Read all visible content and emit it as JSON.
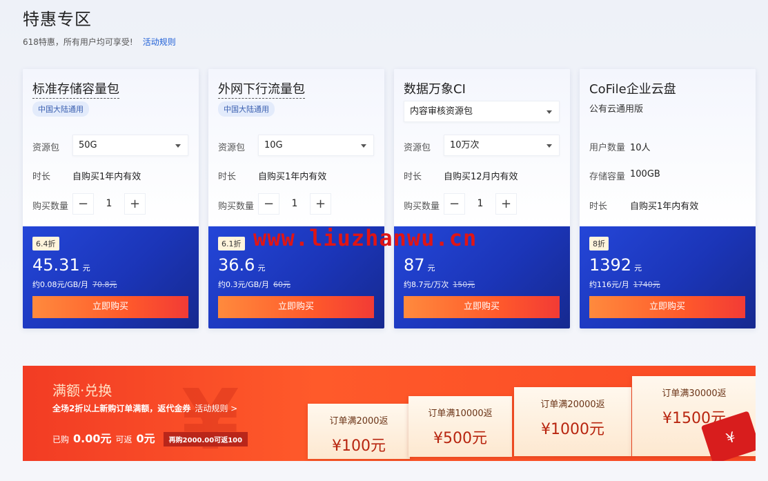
{
  "page": {
    "title": "特惠专区",
    "subtitle": "618特惠，所有用户均可享受!",
    "rules_link": "活动规则"
  },
  "cards": [
    {
      "title": "标准存储容量包",
      "tag": "中国大陆通用",
      "resource_label": "资源包",
      "resource_value": "50G",
      "duration_label": "时长",
      "duration_value": "自购买1年内有效",
      "quantity_label": "购买数量",
      "quantity": "1",
      "discount": "6.4折",
      "price": "45.31",
      "currency": "元",
      "unit_price": "约0.08元/GB/月",
      "original_price": "70.8元",
      "buy_label": "立即购买"
    },
    {
      "title": "外网下行流量包",
      "tag": "中国大陆通用",
      "resource_label": "资源包",
      "resource_value": "10G",
      "duration_label": "时长",
      "duration_value": "自购买1年内有效",
      "quantity_label": "购买数量",
      "quantity": "1",
      "discount": "6.1折",
      "price": "36.6",
      "currency": "元",
      "unit_price": "约0.3元/GB/月",
      "original_price": "60元",
      "buy_label": "立即购买"
    },
    {
      "title": "数据万象CI",
      "type_select": "内容审核资源包",
      "resource_label": "资源包",
      "resource_value": "10万次",
      "duration_label": "时长",
      "duration_value": "自购买12月内有效",
      "quantity_label": "购买数量",
      "quantity": "1",
      "price": "87",
      "currency": "元",
      "unit_price": "约8.7元/万次",
      "original_price": "150元",
      "buy_label": "立即购买"
    },
    {
      "title": "CoFile企业云盘",
      "sub": "公有云通用版",
      "users_label": "用户数量",
      "users_value": "10人",
      "storage_label": "存储容量",
      "storage_value": "100GB",
      "duration_label": "时长",
      "duration_value": "自购买1年内有效",
      "discount": "8折",
      "price": "1392",
      "currency": "元",
      "unit_price": "约116元/月",
      "original_price": "1740元",
      "buy_label": "立即购买"
    }
  ],
  "stepper": {
    "minus": "−",
    "plus": "+"
  },
  "watermark": "www.liuzhanwu.cn",
  "banner": {
    "title": "满额·兑换",
    "desc": "全场2折以上新购订单满额，返代金券",
    "rules_link": "活动规则 >",
    "bought_label": "已购",
    "bought_value": "0.00元",
    "return_label": "可返",
    "return_value": "0元",
    "hint": "再购2000.00可返100",
    "coupons": [
      {
        "title": "订单满2000返",
        "amount": "¥100元"
      },
      {
        "title": "订单满10000返",
        "amount": "¥500元"
      },
      {
        "title": "订单满20000返",
        "amount": "¥1000元"
      },
      {
        "title": "订单满30000返",
        "amount": "¥1500元"
      }
    ],
    "ticket_icon": "¥"
  },
  "colors": {
    "accent_blue": "#1e5fd6",
    "card_bottom": "#1b35b8",
    "buy_button": "#ff5a2b",
    "banner_red": "#f23c24"
  }
}
